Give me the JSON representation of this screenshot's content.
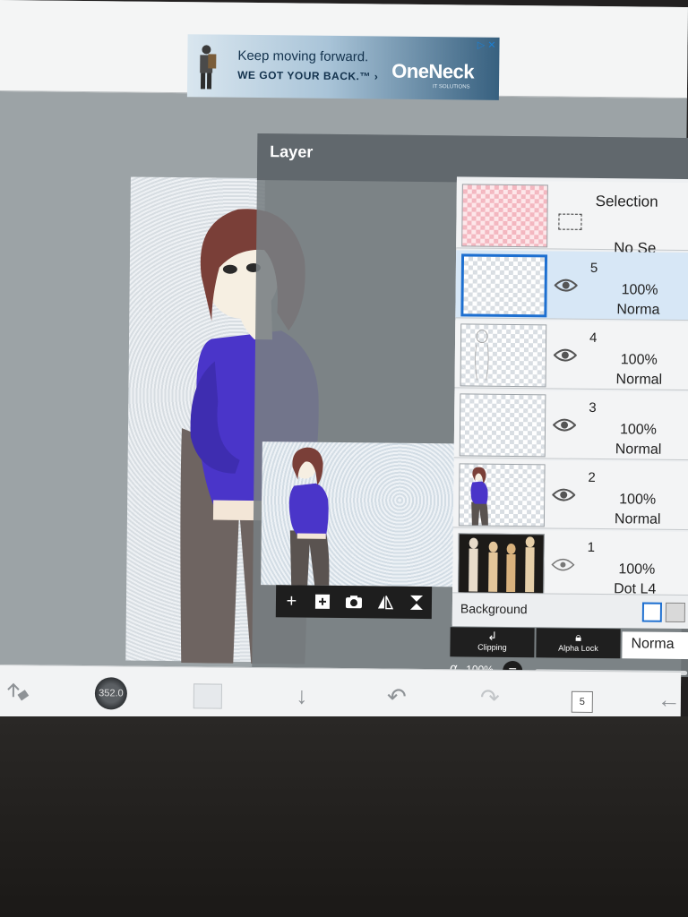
{
  "ad": {
    "headline": "Keep moving forward.",
    "subline": "WE GOT YOUR BACK.™ ›",
    "brand": "OneNeck",
    "tagline": "IT SOLUTIONS",
    "adchoices": "▷ ✕"
  },
  "layer_panel": {
    "title": "Layer",
    "selection_row": {
      "label": "Selection",
      "sub": "No Se"
    },
    "layers": [
      {
        "number": "5",
        "opacity": "100%",
        "mode": "Norma",
        "selected": true
      },
      {
        "number": "4",
        "opacity": "100%",
        "mode": "Normal",
        "selected": false
      },
      {
        "number": "3",
        "opacity": "100%",
        "mode": "Normal",
        "selected": false
      },
      {
        "number": "2",
        "opacity": "100%",
        "mode": "Normal",
        "selected": false
      },
      {
        "number": "1",
        "opacity": "100%",
        "mode": "Dot L4",
        "selected": false
      }
    ],
    "background_label": "Background",
    "clipping_label": "Clipping",
    "alpha_lock_label": "Alpha Lock",
    "blend_mode_value": "Norma",
    "alpha_symbol": "α",
    "alpha_value": "100%"
  },
  "bottom_bar": {
    "brush_size": "352.0",
    "layer_count": "5"
  },
  "colors": {
    "accent": "#1d6fd0",
    "shirt": "#4a35c9",
    "hair": "#7a3f38",
    "pants": "#5a5350"
  }
}
